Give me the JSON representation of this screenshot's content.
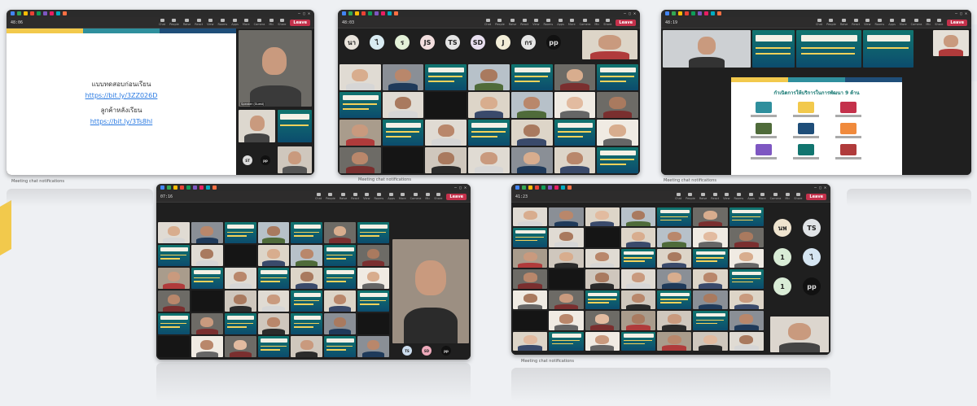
{
  "colors": {
    "leave": "#c4314b",
    "slide_teal": "#11756f",
    "slide_blue": "#0c4c6d",
    "link_blue": "#2a7ae2",
    "band_yellow": "#f2c94c",
    "band_teal": "#2f8f9d"
  },
  "meeting": {
    "leave_label": "Leave",
    "timers": [
      "48:06",
      "48:03",
      "48:19",
      "07:16",
      "41:23"
    ],
    "tools": [
      "Chat",
      "People",
      "Raise",
      "React",
      "View",
      "Rooms",
      "Apps",
      "More",
      "Camera",
      "Mic",
      "Share"
    ],
    "chat_caption": "Meeting chat notifications"
  },
  "panel1": {
    "slide_lines": [
      "แบบทดสอบก่อนเรียน",
      "https://bit.ly/3ZZ026D",
      "ลูกค้าหลังเรียน",
      "https://bit.ly/3Ts8hl"
    ],
    "presenter_name": "Speaker (Guest)"
  },
  "panel2": {
    "avatars": [
      "นา",
      "ไ",
      "ร",
      "JS",
      "TS",
      "SD",
      "J",
      "กร",
      "pp"
    ]
  },
  "panel3": {
    "slide_heading": "กำเนิดการให้บริการในการพัฒนา 9 ด้าน"
  },
  "panel5": {
    "avatars": [
      "นพ",
      "TS",
      "1",
      "ไ",
      "1",
      "pp"
    ]
  }
}
